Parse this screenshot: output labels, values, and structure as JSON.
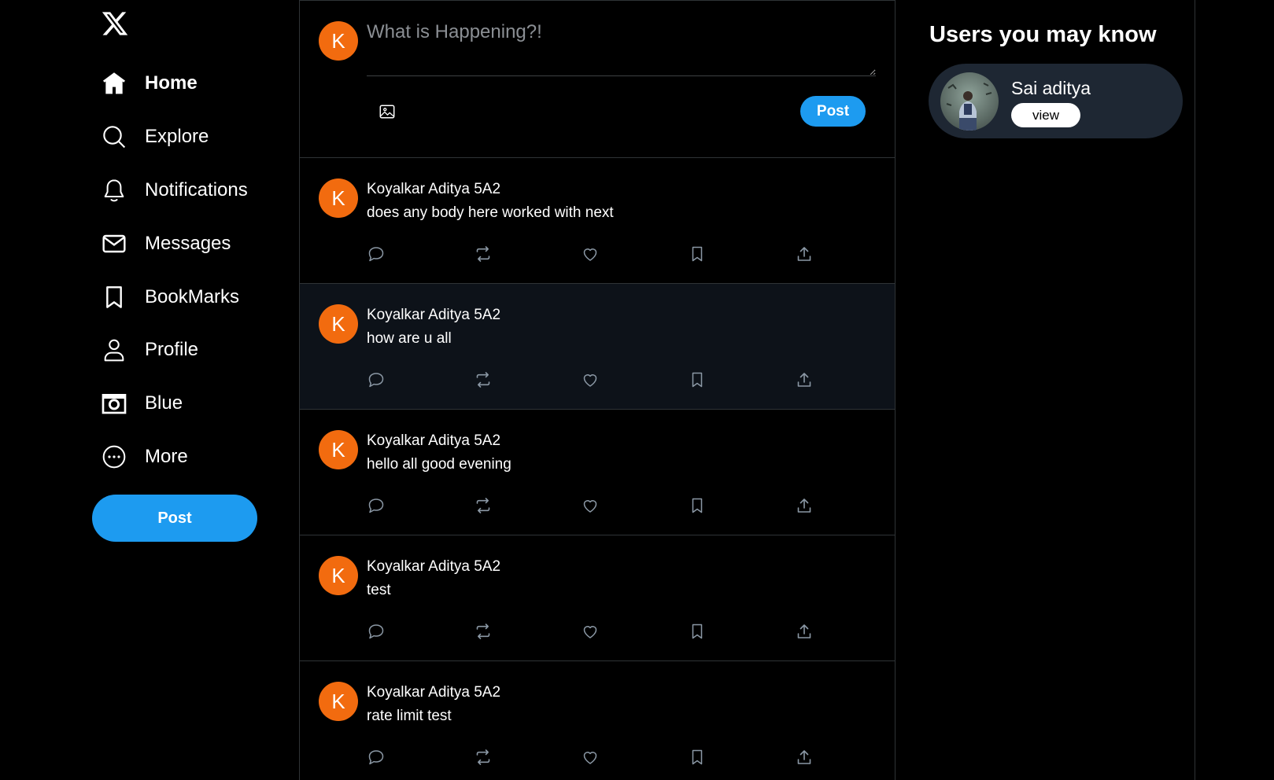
{
  "sidebar": {
    "logo": "x-logo-icon",
    "items": [
      {
        "label": "Home",
        "icon": "home-icon",
        "active": true
      },
      {
        "label": "Explore",
        "icon": "search-icon"
      },
      {
        "label": "Notifications",
        "icon": "bell-icon"
      },
      {
        "label": "Messages",
        "icon": "mail-icon"
      },
      {
        "label": "BookMarks",
        "icon": "bookmark-icon"
      },
      {
        "label": "Profile",
        "icon": "person-icon"
      },
      {
        "label": "Blue",
        "icon": "camera-icon"
      },
      {
        "label": "More",
        "icon": "more-circle-icon"
      }
    ],
    "post_label": "Post"
  },
  "composer": {
    "avatar_letter": "K",
    "placeholder": "What is Happening?!",
    "image_icon": "image-icon",
    "post_label": "Post"
  },
  "posts": [
    {
      "avatar_letter": "K",
      "author": "Koyalkar Aditya 5A2",
      "text": "does any body here worked with next"
    },
    {
      "avatar_letter": "K",
      "author": "Koyalkar Aditya 5A2",
      "text": "how are u all"
    },
    {
      "avatar_letter": "K",
      "author": "Koyalkar Aditya 5A2",
      "text": "hello all good evening"
    },
    {
      "avatar_letter": "K",
      "author": "Koyalkar Aditya 5A2",
      "text": "test"
    },
    {
      "avatar_letter": "K",
      "author": "Koyalkar Aditya 5A2",
      "text": "rate limit test"
    }
  ],
  "post_action_icons": [
    "reply-icon",
    "repost-icon",
    "like-icon",
    "bookmark-icon",
    "share-icon"
  ],
  "suggestions": {
    "title": "Users you may know",
    "users": [
      {
        "name": "Sai aditya",
        "button_label": "view"
      }
    ]
  },
  "colors": {
    "accent": "#1d9bf0",
    "avatar": "#f26b0f",
    "background": "#000000",
    "card": "#1e2733"
  }
}
